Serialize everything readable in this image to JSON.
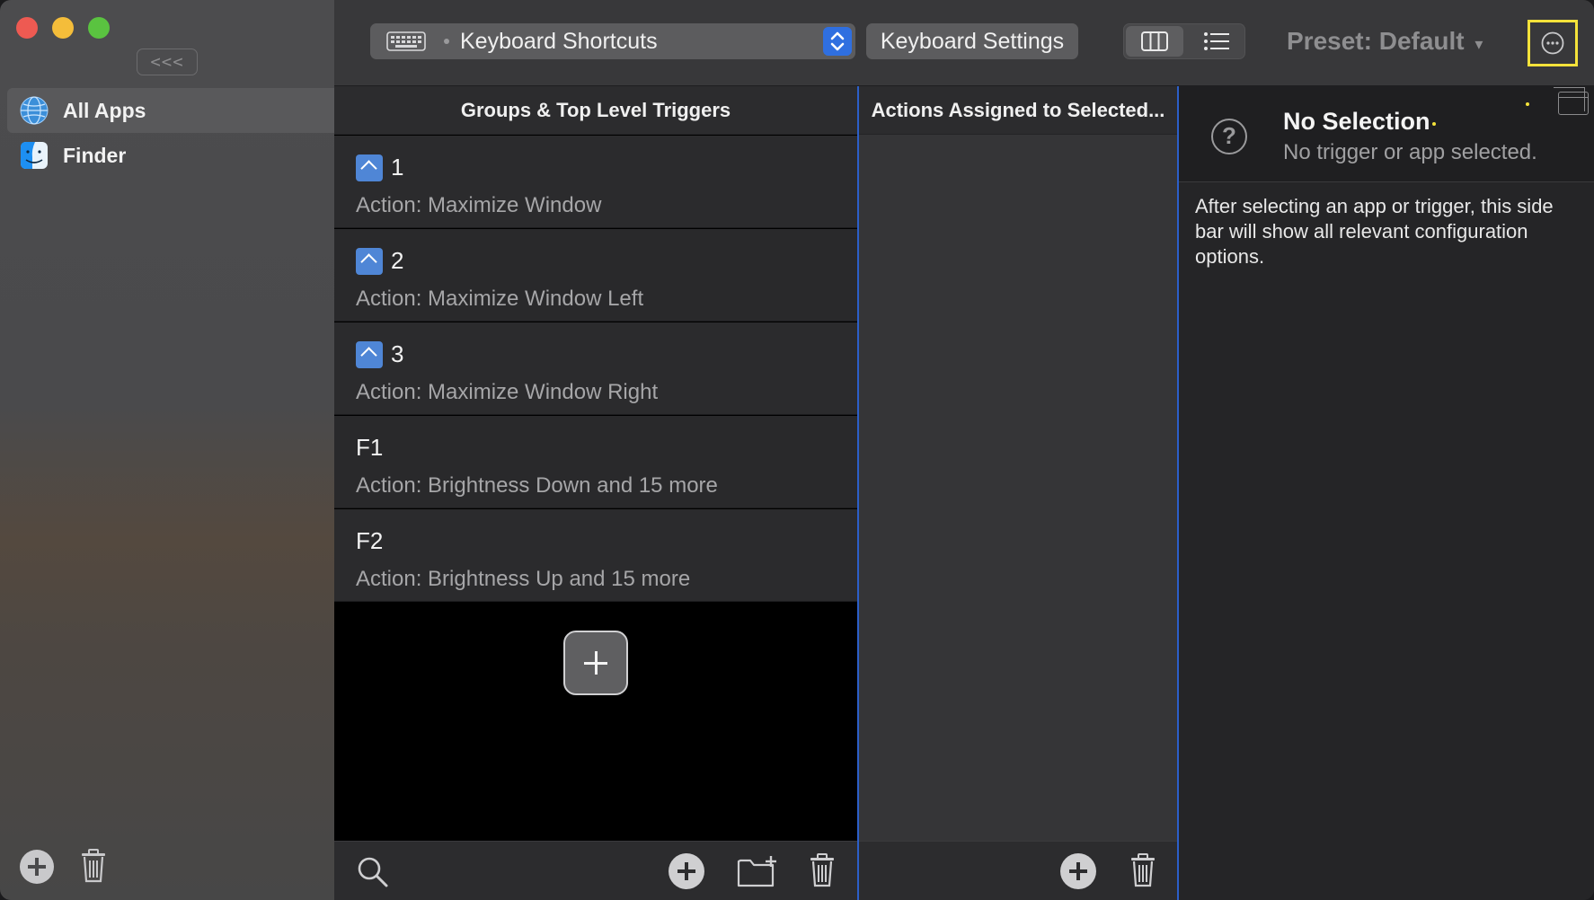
{
  "sidebar": {
    "collapse_label": "<<<",
    "apps": [
      {
        "label": "All Apps",
        "icon": "globe-icon"
      },
      {
        "label": "Finder",
        "icon": "finder-icon"
      }
    ]
  },
  "toolbar": {
    "mode_label": "Keyboard Shortcuts",
    "settings_label": "Keyboard Settings",
    "preset_label": "Preset: Default",
    "preset_arrow": "▾"
  },
  "triggers": {
    "header": "Groups & Top Level Triggers",
    "rows": [
      {
        "key": "1",
        "modifier": "ctrl",
        "action": "Action: Maximize Window"
      },
      {
        "key": "2",
        "modifier": "ctrl",
        "action": "Action: Maximize Window Left"
      },
      {
        "key": "3",
        "modifier": "ctrl",
        "action": "Action: Maximize Window Right"
      },
      {
        "key": "F1",
        "modifier": "",
        "action": "Action: Brightness Down and 15 more"
      },
      {
        "key": "F2",
        "modifier": "",
        "action": "Action: Brightness Up and 15 more"
      }
    ]
  },
  "actions": {
    "header": "Actions Assigned to Selected..."
  },
  "inspector": {
    "title": "No Selection",
    "subtitle": "No trigger or app selected.",
    "body": "After selecting an app or trigger, this side bar will show all relevant configuration options."
  },
  "colors": {
    "accent": "#2f6fe0",
    "highlight": "#f4e23a",
    "modifier_key": "#4f86d6"
  }
}
